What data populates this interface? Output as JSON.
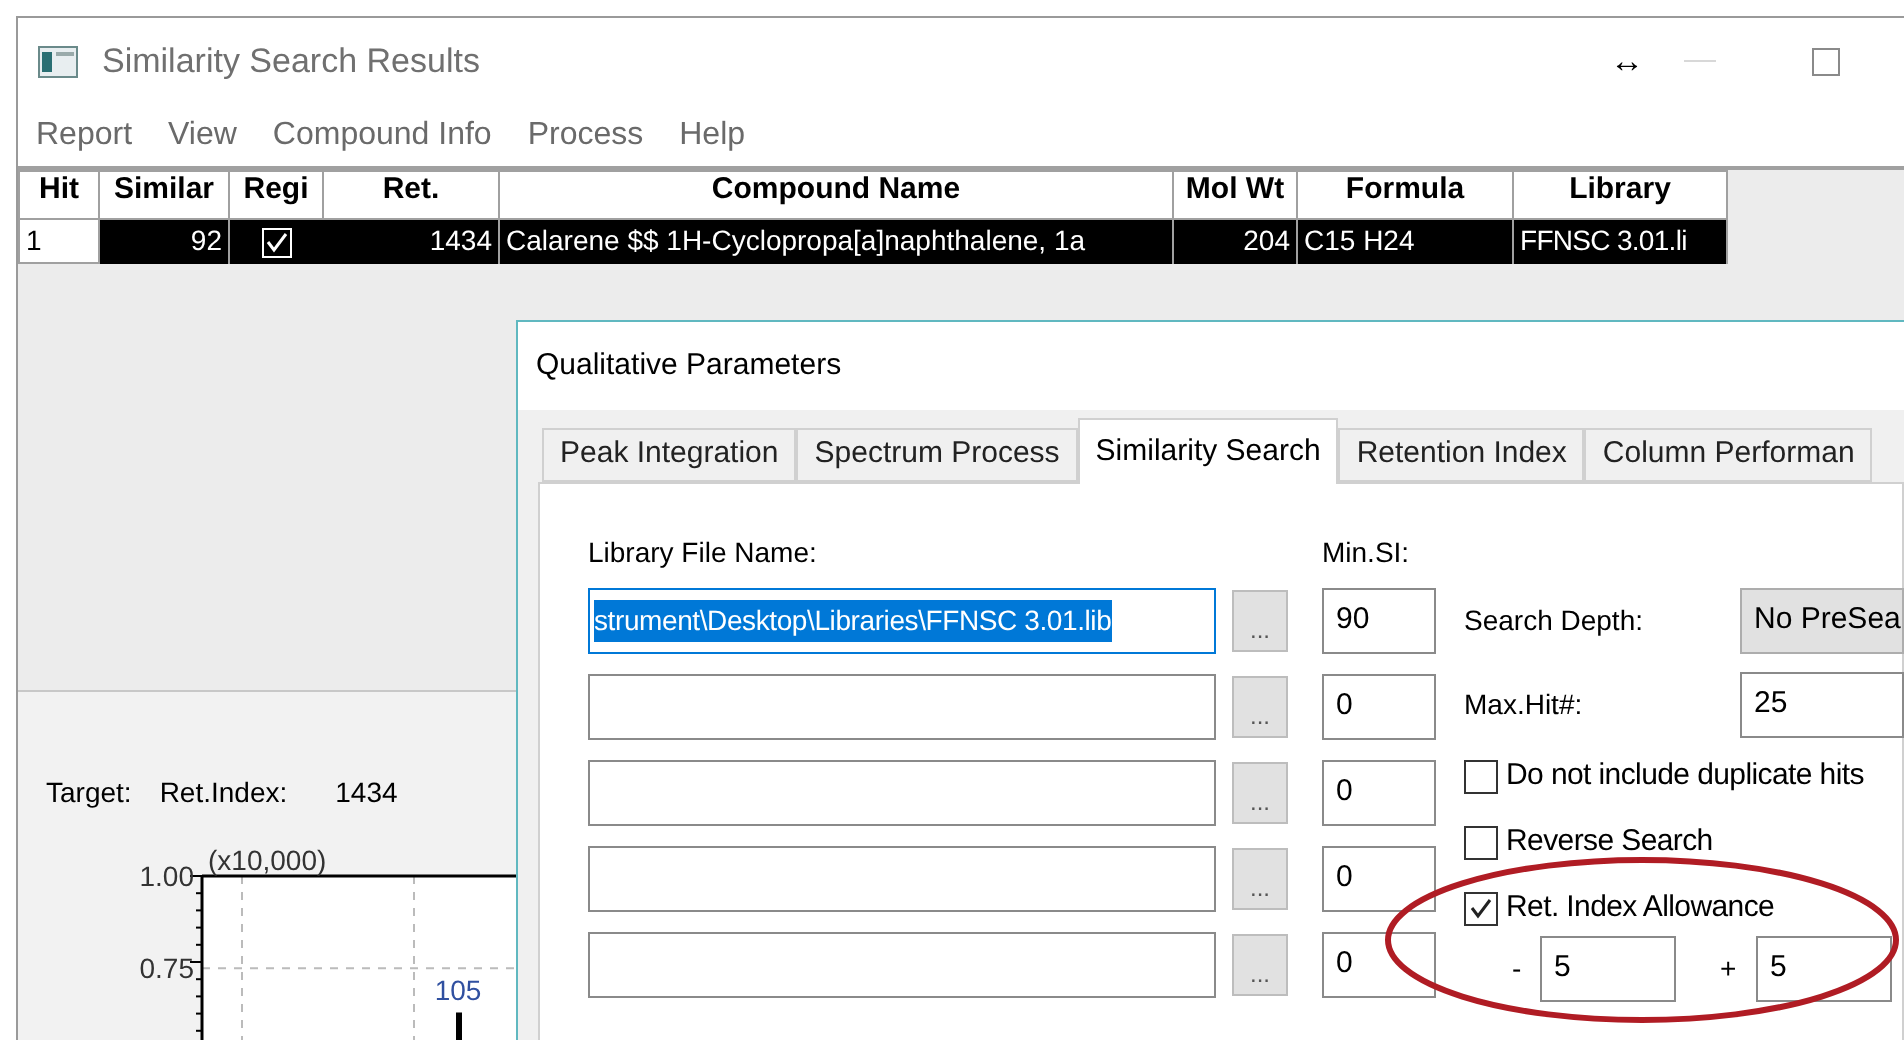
{
  "window": {
    "title": "Similarity Search Results"
  },
  "title_bar_controls": [
    "↔"
  ],
  "menu": [
    "Report",
    "View",
    "Compound Info",
    "Process",
    "Help"
  ],
  "table": {
    "columns": [
      "Hit",
      "Similar",
      "Regi",
      "Ret.",
      "Compound Name",
      "Mol Wt",
      "Formula",
      "Library"
    ],
    "rows": [
      {
        "hit": "1",
        "similarity": "92",
        "registered": true,
        "ret_index": "1434",
        "compound_name": "Calarene $$ 1H-Cyclopropa[a]naphthalene, 1a",
        "mol_wt": "204",
        "formula": "C15 H24",
        "library": "FFNSC 3.01.li",
        "selected": true
      }
    ]
  },
  "target": {
    "label": "Target:",
    "ret_index_label": "Ret.Index:",
    "ret_index": "1434"
  },
  "spectrum": {
    "chart_data": {
      "type": "bar",
      "categories": [
        "105"
      ],
      "values": [
        0.63
      ],
      "ylim": [
        0.55,
        1
      ],
      "yticks": [
        {
          "value": 1,
          "label": "1.00"
        },
        {
          "value": 0.75,
          "label": "0.75"
        }
      ],
      "annotations": [
        "(x10,000)"
      ]
    }
  },
  "dialog": {
    "title": "Qualitative Parameters",
    "tabs": [
      {
        "label": "Peak Integration",
        "selected": false
      },
      {
        "label": "Spectrum Process",
        "selected": false
      },
      {
        "label": "Similarity Search",
        "selected": true
      },
      {
        "label": "Retention Index",
        "selected": false
      },
      {
        "label": "Column Performan",
        "selected": false
      }
    ],
    "library_label": "Library File Name:",
    "min_si_label": "Min.SI:",
    "libraries": [
      {
        "path": "strument\\Desktop\\Libraries\\FFNSC 3.01.lib",
        "text_selected": true,
        "browse": "...",
        "min_si": "90"
      },
      {
        "text_selected": false,
        "browse": "...",
        "min_si": "0"
      },
      {
        "text_selected": false,
        "browse": "...",
        "min_si": "0"
      },
      {
        "text_selected": false,
        "browse": "...",
        "min_si": "0"
      },
      {
        "text_selected": false,
        "browse": "...",
        "min_si": "0"
      }
    ],
    "search_depth": {
      "label": "Search Depth:",
      "value": "No PreSea"
    },
    "max_hit": {
      "label": "Max.Hit#:",
      "value": "25"
    },
    "options": [
      {
        "label": "Do not include duplicate hits",
        "checked": false
      },
      {
        "label": "Reverse Search",
        "checked": false
      },
      {
        "label": "Ret. Index Allowance",
        "checked": true
      }
    ],
    "allowance": {
      "minus_label": "-",
      "minus": "5",
      "plus_label": "+",
      "plus": "5"
    },
    "highlight_ellipse": true
  }
}
